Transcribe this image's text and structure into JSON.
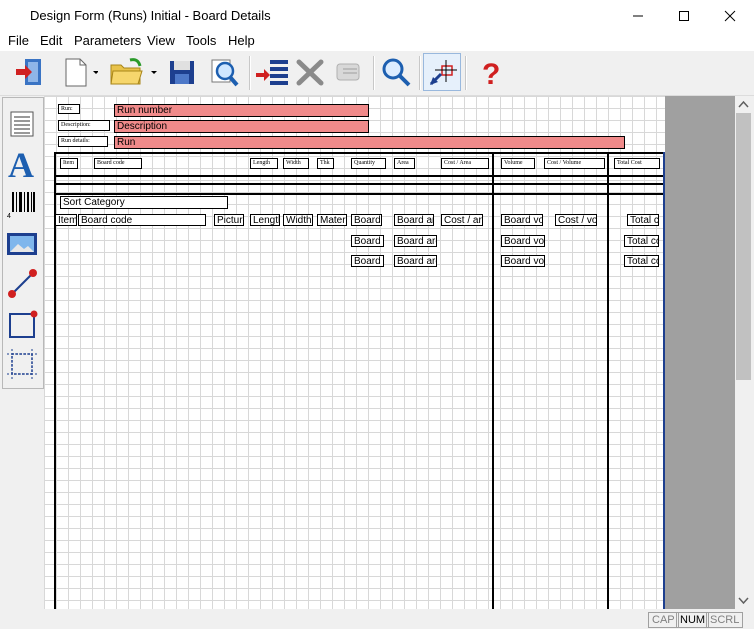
{
  "window": {
    "title": "Design Form (Runs) Initial - Board Details"
  },
  "menu": [
    "File",
    "Edit",
    "Parameters",
    "View",
    "Tools",
    "Help"
  ],
  "toolbar": {
    "icons": [
      "exit-icon",
      "new-icon",
      "open-folder-icon",
      "save-icon",
      "print-preview-icon",
      "insert-section-icon",
      "delete-icon",
      "paste-disabled-icon",
      "zoom-icon",
      "select-pointer-icon",
      "help-icon"
    ]
  },
  "sidebar": {
    "icons": [
      "paper-text-icon",
      "text-icon",
      "barcode-icon",
      "picture-icon",
      "line-icon",
      "rectangle-icon",
      "frame-icon"
    ]
  },
  "header": {
    "run_label": "Run:",
    "run_number": "Run number",
    "description_label": "Description:",
    "description": "Description",
    "run_details_label": "Run details:",
    "run": "Run",
    "columns": [
      "Item",
      "Board code",
      "Length",
      "Width",
      "Thk",
      "Quantity",
      "Area",
      "Cost / Area",
      "Volume",
      "Cost / Volume",
      "Total Cost"
    ]
  },
  "detail": {
    "sort_category": "Sort Category",
    "row1": [
      "Item",
      "Board code",
      "Picture",
      "Length",
      "Width",
      "Material",
      "Board",
      "Board area",
      "Cost / area",
      "Board vol",
      "Cost / vol",
      "Total cost"
    ],
    "row2": [
      "Board",
      "Board area",
      "Board vol",
      "Total cost"
    ],
    "row3": [
      "Board",
      "Board area",
      "Board vol",
      "Total cost"
    ]
  },
  "status": [
    "CAP",
    "NUM",
    "SCRL"
  ],
  "colors": {
    "field_red": "#f08a8a",
    "grid": "#d8d8d8",
    "panel_gray": "#a0a0a0"
  }
}
